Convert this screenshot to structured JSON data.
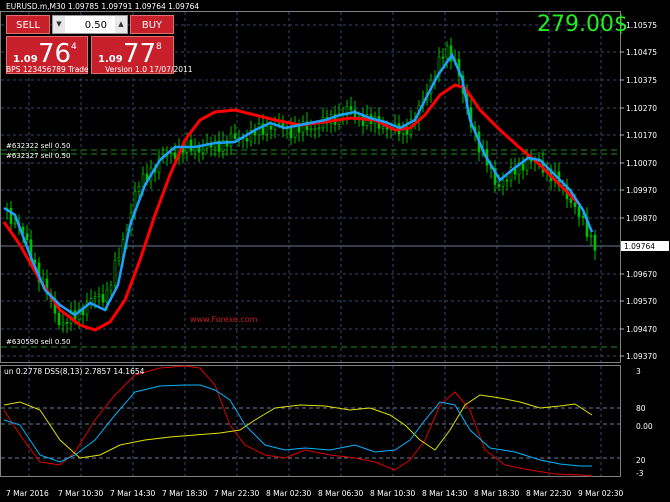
{
  "header": {
    "symbol_line": "EURUSD.m,M30  1.09785 1.09791 1.09764 1.09764",
    "profit": "279.00$"
  },
  "trade_panel": {
    "sell_label": "SELL",
    "buy_label": "BUY",
    "lot_value": "0.50",
    "sell_price": {
      "small": "1.09",
      "big": "76",
      "pip": "4"
    },
    "buy_price": {
      "small": "1.09",
      "big": "77",
      "pip": "8"
    },
    "info": [
      "BPS 123456789 Trade",
      "Version 1.0  17/07/2011"
    ]
  },
  "price_axis": {
    "labels": [
      "1.10575",
      "1.10475",
      "1.10375",
      "1.10270",
      "1.10170",
      "1.10070",
      "1.09970",
      "1.09870",
      "1.09670",
      "1.09570",
      "1.09470",
      "1.09370"
    ],
    "current": "1.09764"
  },
  "order_lines": [
    {
      "label": "#632322 sell 0.50"
    },
    {
      "label": "#632327 sell 0.50"
    },
    {
      "label": "#630590 sell 0.50"
    }
  ],
  "watermark": "www.Forexe.com",
  "indicator": {
    "title": "un 0.2778  DSS(8,13) 2.7857 14.1654",
    "axis_labels": [
      "3",
      "80",
      "0.00",
      "20",
      "-3"
    ]
  },
  "time_axis": [
    "7 Mar 2016",
    "7 Mar 10:30",
    "7 Mar 14:30",
    "7 Mar 18:30",
    "7 Mar 22:30",
    "8 Mar 02:30",
    "8 Mar 06:30",
    "8 Mar 10:30",
    "8 Mar 14:30",
    "8 Mar 18:30",
    "8 Mar 22:30",
    "9 Mar 02:30"
  ],
  "colors": {
    "up_candle": "#00c000",
    "ma_red": "#ff0000",
    "ma_blue": "#1ea0ff",
    "grid": "#36486a",
    "order_line": "#1e8c1e",
    "profit": "#22ee22",
    "ind_red": "#dd0000",
    "ind_yellow": "#e0e000",
    "ind_blue": "#00b4ff"
  }
}
